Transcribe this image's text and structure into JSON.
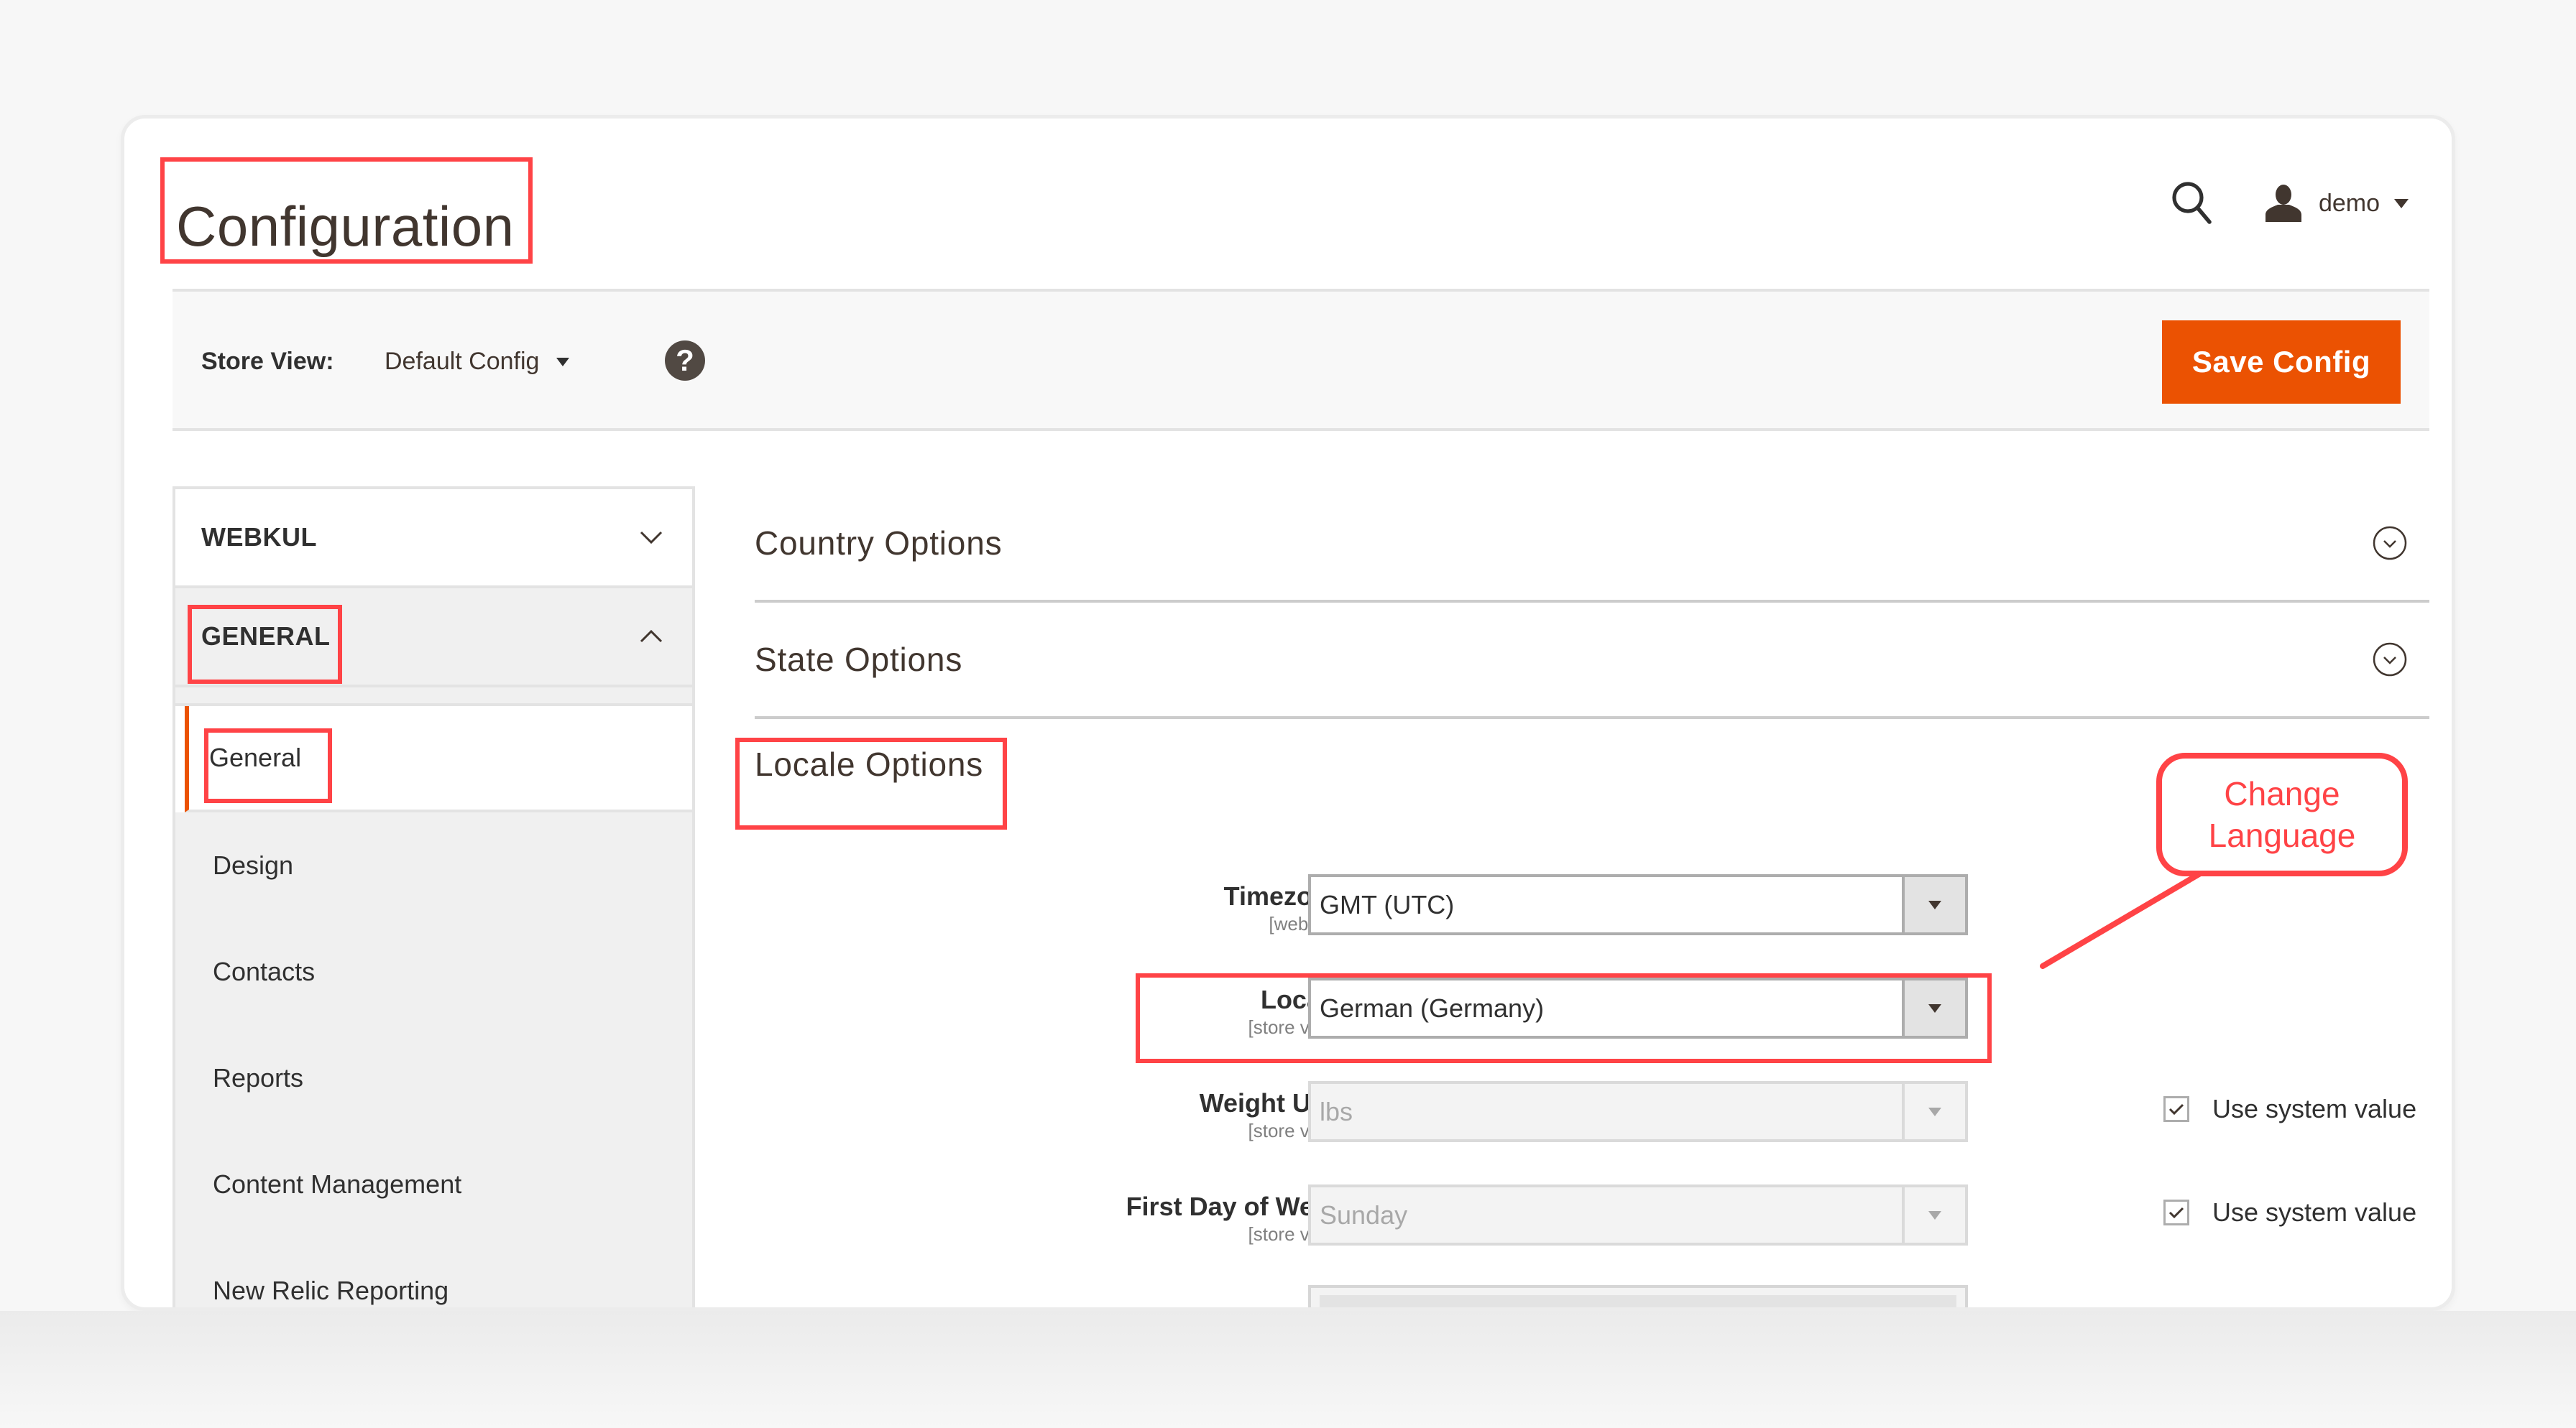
{
  "header": {
    "title": "Configuration",
    "user_name": "demo",
    "icons": {
      "search": "search-icon",
      "user": "user-icon",
      "user_caret": "caret-down-icon"
    }
  },
  "store_bar": {
    "label": "Store View:",
    "value": "Default Config",
    "help_icon": "?",
    "save_label": "Save Config"
  },
  "sidebar": {
    "groups": [
      {
        "label": "WEBKUL",
        "expanded": false
      },
      {
        "label": "GENERAL",
        "expanded": true
      }
    ],
    "items": [
      {
        "label": "General",
        "active": true
      },
      {
        "label": "Design",
        "active": false
      },
      {
        "label": "Contacts",
        "active": false
      },
      {
        "label": "Reports",
        "active": false
      },
      {
        "label": "Content Management",
        "active": false
      },
      {
        "label": "New Relic Reporting",
        "active": false
      }
    ]
  },
  "main": {
    "sections": [
      {
        "title": "Country Options",
        "collapsed": true
      },
      {
        "title": "State Options",
        "collapsed": true
      },
      {
        "title": "Locale Options",
        "collapsed": false
      }
    ],
    "fields": [
      {
        "label": "Timezone",
        "scope": "[website]",
        "value": "GMT (UTC)",
        "disabled": false,
        "use_system_value": null
      },
      {
        "label": "Locale",
        "scope": "[store view]",
        "value": "German (Germany)",
        "disabled": false,
        "use_system_value": null
      },
      {
        "label": "Weight Unit",
        "scope": "[store view]",
        "value": "lbs",
        "disabled": true,
        "use_system_value": true,
        "checkbox_label": "Use system value"
      },
      {
        "label": "First Day of Week",
        "scope": "[store view]",
        "value": "Sunday",
        "disabled": true,
        "use_system_value": true,
        "checkbox_label": "Use system value"
      }
    ]
  },
  "annotation": {
    "callout_text_line1": "Change",
    "callout_text_line2": "Language",
    "color": "#ff4346"
  },
  "colors": {
    "accent": "#eb5202",
    "text": "#303030",
    "annotation": "#ff4346"
  }
}
